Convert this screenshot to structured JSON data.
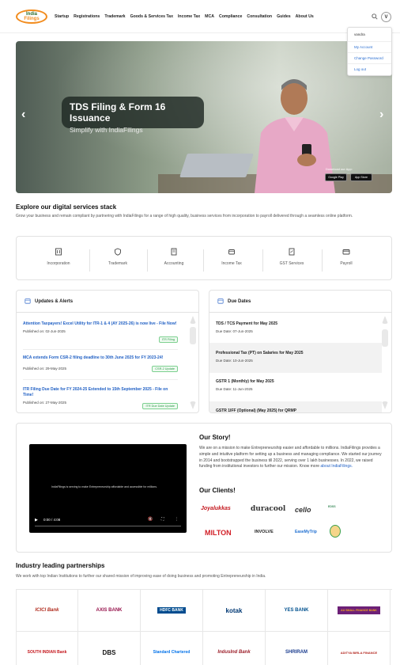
{
  "header": {
    "logo_line1": "India",
    "logo_line2": "Filings",
    "nav": [
      "Startup",
      "Registrations",
      "Trademark",
      "Goods & Services Tax",
      "Income Tax",
      "MCA",
      "Compliance",
      "Consultation",
      "Guides",
      "About Us"
    ],
    "avatar_initial": "V",
    "search_icon": "search-icon"
  },
  "user_menu": {
    "username": "vandra",
    "items": [
      "My Account",
      "Change Password",
      "Log out"
    ]
  },
  "hero": {
    "title": "TDS Filing & Form 16 Issuance",
    "subtitle": "Simplify with IndiaFilings",
    "download_label": "Download our App:",
    "google_play": "Google Play",
    "app_store": "App Store",
    "prev": "‹",
    "next": "›"
  },
  "explore": {
    "heading": "Explore our digital services stack",
    "description": "Grow your business and remain compliant by partnering with IndiaFilings for a range of high quality, business services from incorporation to payroll delivered through a seamless online platform.",
    "services": [
      {
        "label": "Incorporation",
        "icon": "building-icon"
      },
      {
        "label": "Trademark",
        "icon": "shield-icon"
      },
      {
        "label": "Accounting",
        "icon": "ledger-icon"
      },
      {
        "label": "Income Tax",
        "icon": "wallet-icon"
      },
      {
        "label": "GST Services",
        "icon": "document-icon"
      },
      {
        "label": "Payroll",
        "icon": "card-icon"
      }
    ]
  },
  "updates": {
    "title": "Updates & Alerts",
    "items": [
      {
        "title": "Attention Taxpayers! Excel Utility for ITR-1 & 4 (AY 2025-26) is now live - File Now!",
        "published": "Published on: 02-Jun-2025",
        "tag": "ITR Filing"
      },
      {
        "title": "MCA extends Form CSR-2 filing deadline to 30th June 2025 for FY 2023-24!",
        "published": "Published on: 29-May-2025",
        "tag": "CSR-2 Update"
      },
      {
        "title": "ITR Filing Due Date for FY 2024-25 Extended to 15th September 2025 - File on Time!",
        "published": "Published on: 27-May-2025",
        "tag": "ITR Due Date Update"
      }
    ]
  },
  "due_dates": {
    "title": "Due Dates",
    "items": [
      {
        "title": "TDS / TCS Payment for May 2025",
        "date": "Due Date: 07-Jun-2025"
      },
      {
        "title": "Professional Tax (PT) on Salaries for May 2025",
        "date": "Due Date: 10-Jun-2025"
      },
      {
        "title": "GSTR 1 (Monthly) for May 2025",
        "date": "Due Date: 11-Jun-2025"
      },
      {
        "title": "GSTR 1IFF (Optional) (May 2025) for QRMP",
        "date": ""
      }
    ]
  },
  "story": {
    "heading": "Our Story!",
    "text": "We are on a mission to make Entrepreneurship easier and affordable to millions. IndiaFilings provides a simple and intuitive platform for setting up a business and managing compliance. We started our journey in 2014 and bootstrapped the business till 2022, serving over 1 lakh businesses. In 2022, we raised funding from institutional investors to further our mission. Know more",
    "link": "about IndiaFilings.",
    "video_caption": "IndiaFilings is serving to make Entrepreneurship affordable and accessible for millions.",
    "video_time": "0:00 / 4:08",
    "clients_heading": "Our Clients!",
    "clients": [
      "Joyalukkas",
      "duracool",
      "cello",
      "EDSS",
      "MILTON",
      "INVOLVE",
      "EaseMyTrip",
      "Emblem"
    ]
  },
  "partnerships": {
    "heading": "Industry leading partnerships",
    "description": "We work with top Indian Institutions to further our shared mission of improving ease of doing business and promoting Entrepreneurship in India.",
    "banks": [
      "ICICI Bank",
      "AXIS BANK",
      "HDFC BANK",
      "kotak",
      "YES BANK",
      "AU SMALL FINANCE BANK",
      "SOUTH INDIAN Bank",
      "DBS",
      "Standard Chartered",
      "IndusInd Bank",
      "SHRIRAM",
      "ADITYA BIRLA FINANCE"
    ]
  },
  "colors": {
    "link_blue": "#1f5fc4",
    "tag_green": "#2e9a4b",
    "logo_orange": "#f28c1e"
  }
}
